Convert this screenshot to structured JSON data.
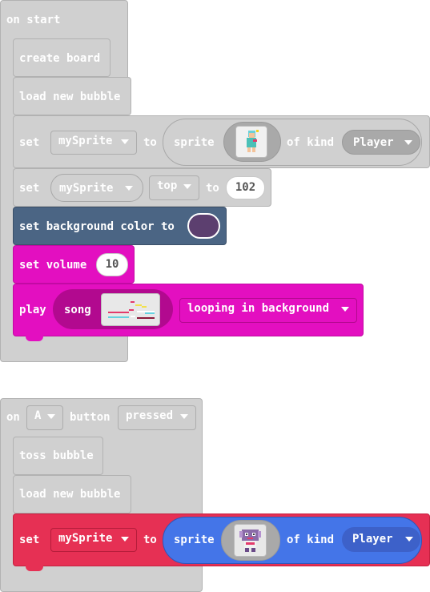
{
  "start_block": {
    "header": "on start",
    "create_board": "create board",
    "load_bubble": "load new bubble",
    "set_sprite": {
      "set": "set",
      "variable": "mySprite",
      "to": "to",
      "sprite": "sprite",
      "of_kind": "of kind",
      "kind": "Player"
    },
    "set_top": {
      "set": "set",
      "variable": "mySprite",
      "property": "top",
      "to": "to",
      "value": "102"
    },
    "background": {
      "label": "set background color to",
      "swatch_color": "#5c3f6f"
    },
    "volume": {
      "label": "set volume",
      "value": "10"
    },
    "play": {
      "play": "play",
      "song": "song",
      "mode": "looping in background"
    }
  },
  "button_block": {
    "on": "on",
    "button_name": "A",
    "button_word": "button",
    "event": "pressed",
    "toss": "toss bubble",
    "load_bubble": "load new bubble",
    "set_sprite": {
      "set": "set",
      "variable": "mySprite",
      "to": "to",
      "sprite": "sprite",
      "of_kind": "of kind",
      "kind": "Player"
    }
  },
  "colors": {
    "looks_grey": "#d0d0d0",
    "scene": "#4b6584",
    "music": "#e30fc0",
    "variables": "#e63054",
    "sprites": "#4475e8"
  }
}
